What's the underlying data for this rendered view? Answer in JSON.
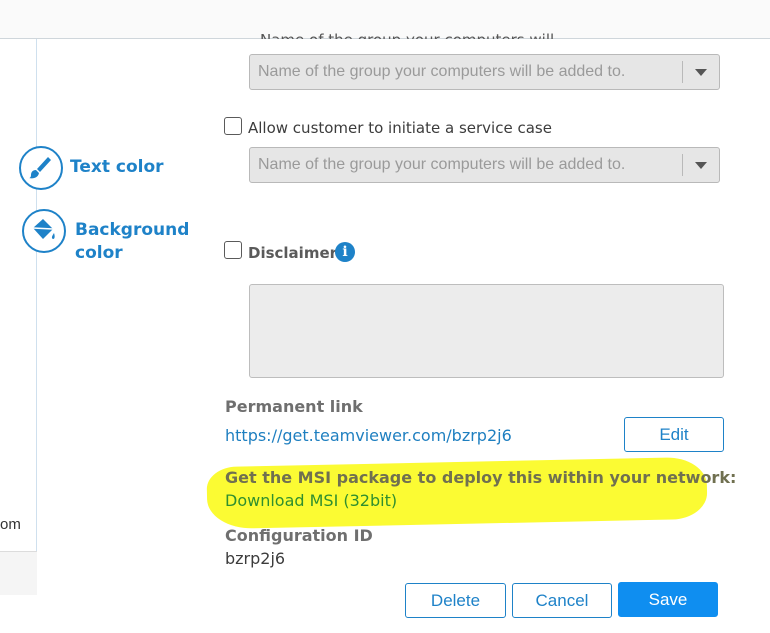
{
  "top": {
    "cut_text": "Name of the group your computers will be added to"
  },
  "left_panel": {
    "partial_text": "om"
  },
  "sidebar": {
    "text_color": {
      "label": "Text color",
      "icon": "brush-icon"
    },
    "background_color": {
      "label": "Background color",
      "label_line1": "Background",
      "label_line2": "color",
      "icon": "paint-bucket-icon"
    }
  },
  "form": {
    "group_select_1": {
      "placeholder": "Name of the group your computers will be added to."
    },
    "allow_service_case": {
      "label": "Allow customer to initiate a service case",
      "checked": false
    },
    "group_select_2": {
      "placeholder": "Name of the group your computers will be added to."
    },
    "disclaimer": {
      "label": "Disclaimer",
      "checked": false,
      "info_icon": "i",
      "value": ""
    },
    "permanent_link": {
      "title": "Permanent link",
      "url": "https://get.teamviewer.com/bzrp2j6",
      "edit_label": "Edit"
    },
    "msi": {
      "title": "Get the MSI package to deploy this within your network:",
      "link_label": "Download MSI (32bit)",
      "highlight_color": "#fbfb33"
    },
    "configuration": {
      "title": "Configuration ID",
      "value": "bzrp2j6"
    }
  },
  "actions": {
    "delete_label": "Delete",
    "cancel_label": "Cancel",
    "save_label": "Save"
  },
  "colors": {
    "accent": "#1e82c8",
    "primary_button": "#0f8ef0"
  }
}
